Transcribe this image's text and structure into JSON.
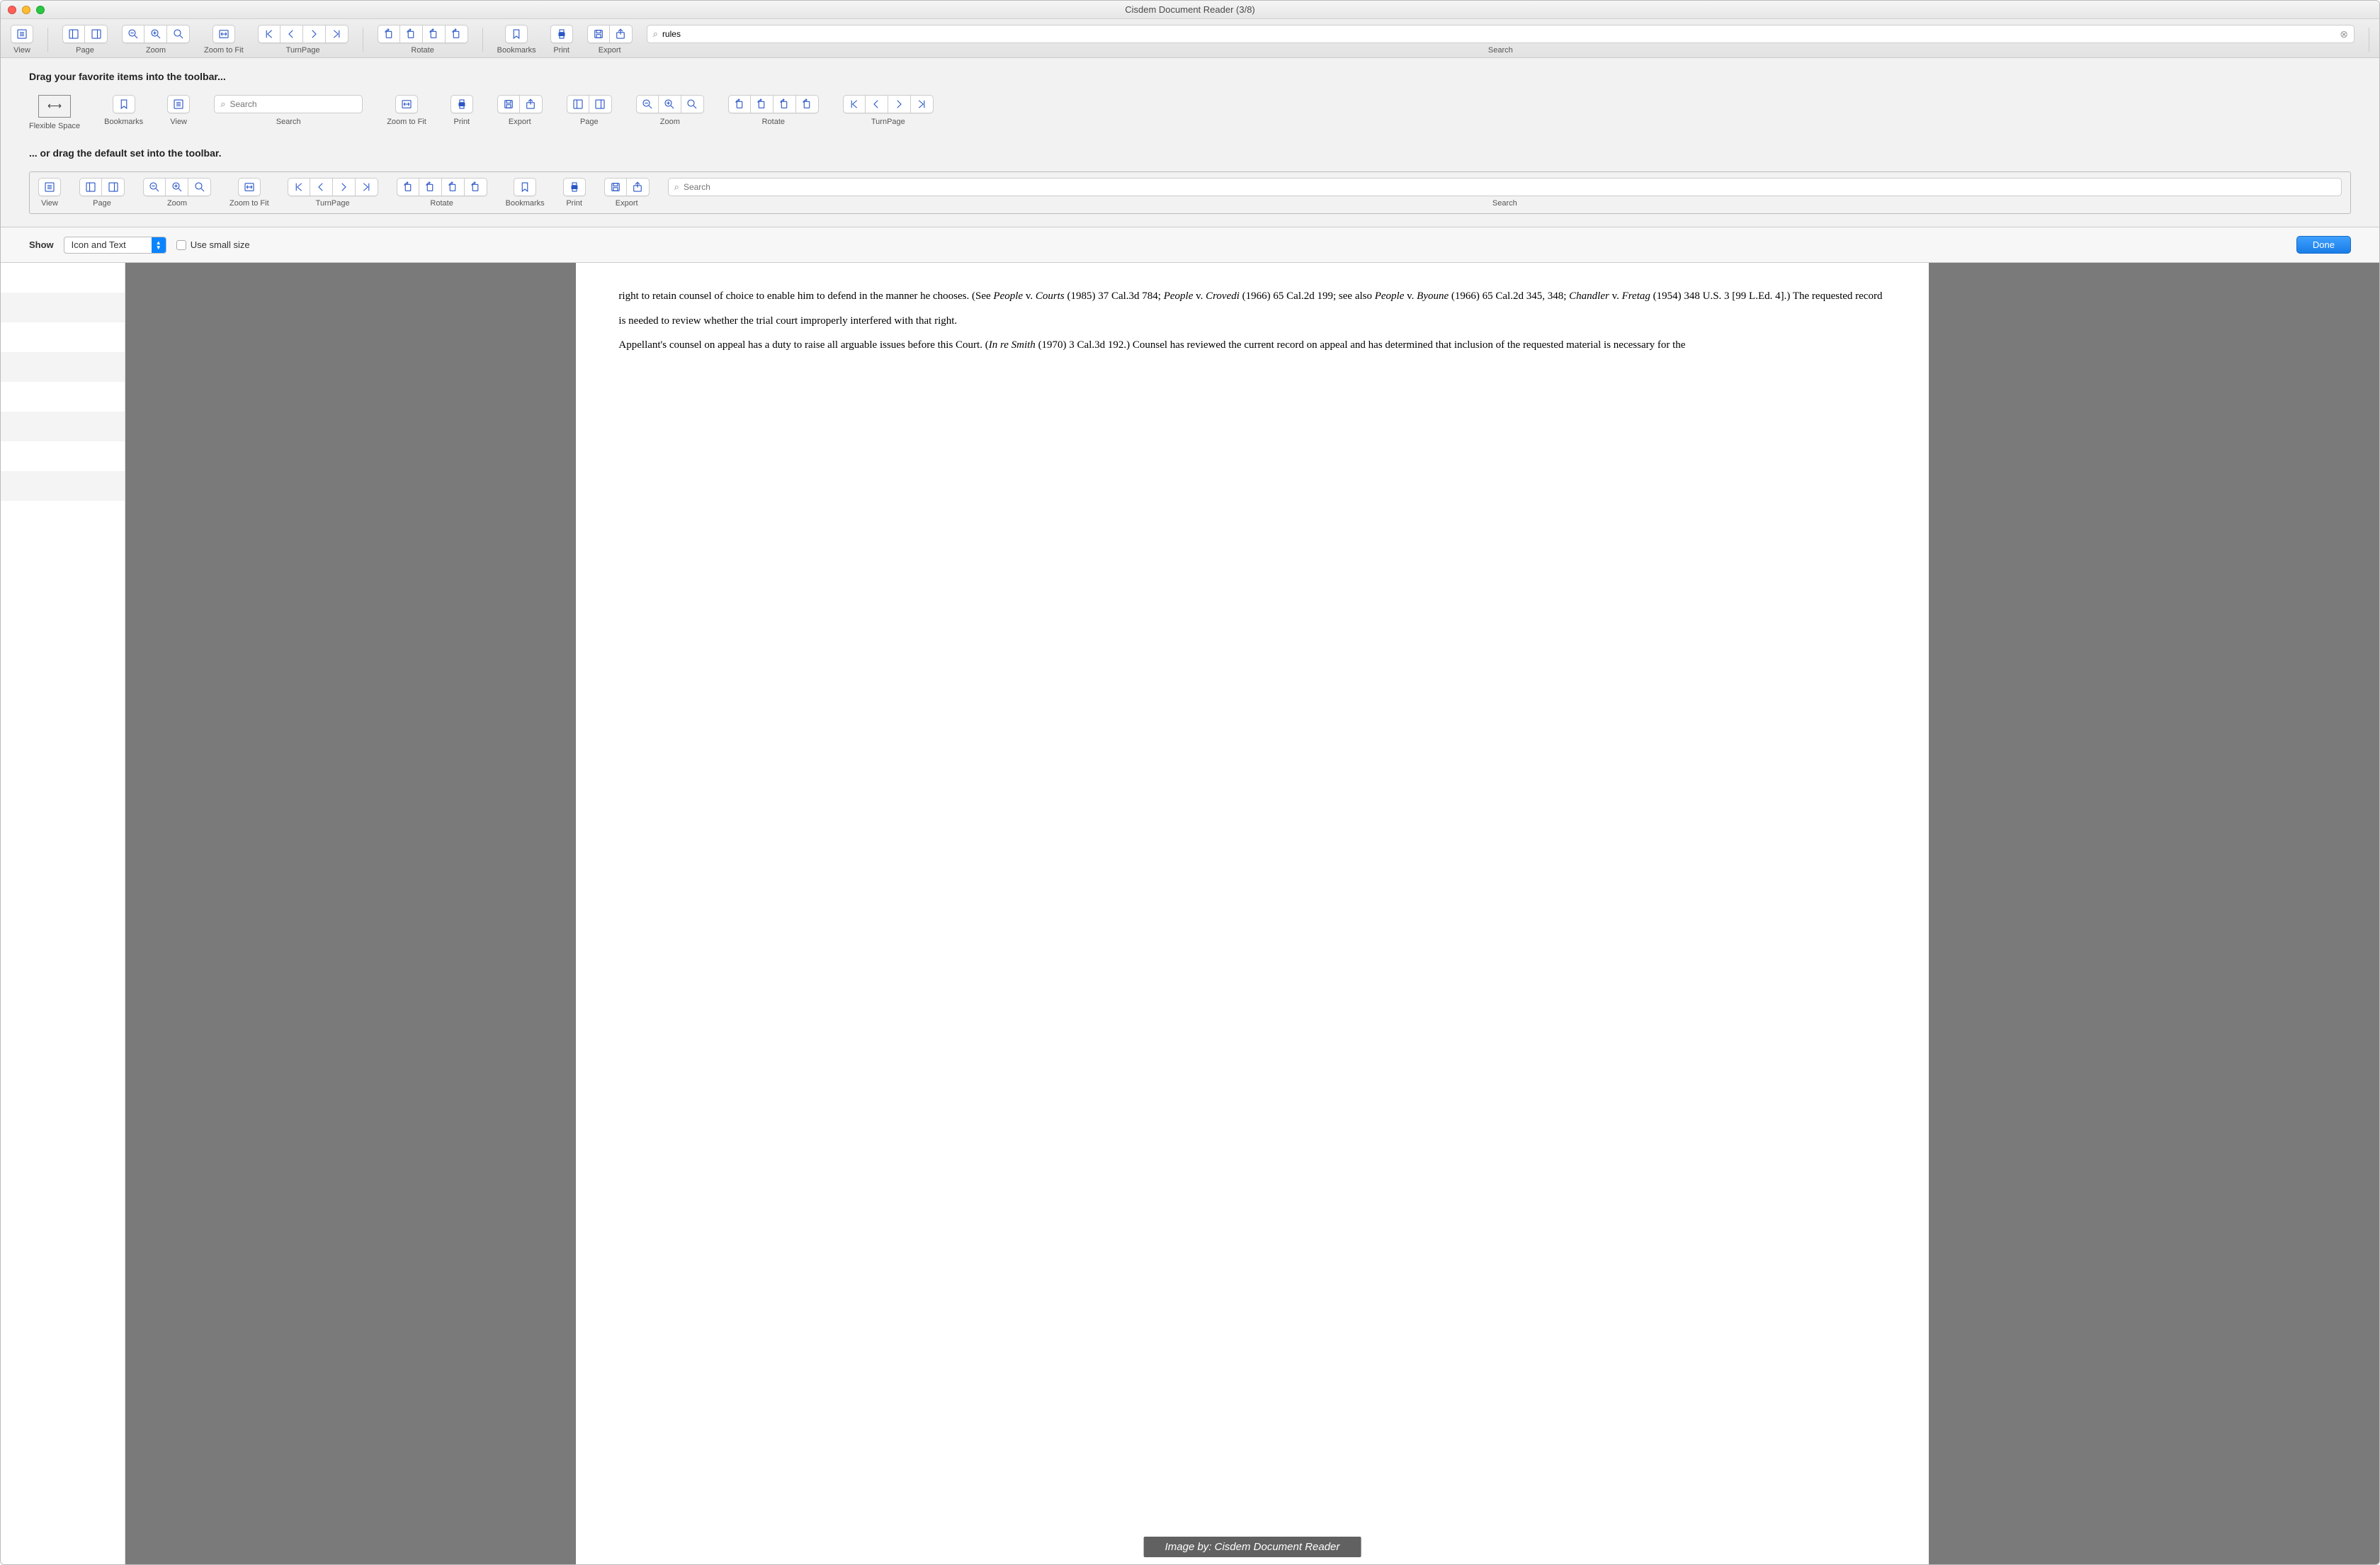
{
  "window": {
    "title": "Cisdem Document Reader (3/8)"
  },
  "toolbar": {
    "view": "View",
    "page": "Page",
    "zoom": "Zoom",
    "zoomfit": "Zoom to Fit",
    "turnpage": "TurnPage",
    "rotate": "Rotate",
    "bookmarks": "Bookmarks",
    "print": "Print",
    "export": "Export",
    "search": "Search",
    "search_value": "rules"
  },
  "customize": {
    "heading1": "Drag your favorite items into the toolbar...",
    "heading2": "... or drag the default set into the toolbar.",
    "items": {
      "flexspace": "Flexible Space",
      "bookmarks": "Bookmarks",
      "view": "View",
      "search": "Search",
      "zoomfit": "Zoom to Fit",
      "print": "Print",
      "export": "Export",
      "page": "Page",
      "zoom": "Zoom",
      "rotate": "Rotate",
      "turnpage": "TurnPage",
      "search_placeholder": "Search"
    },
    "default_labels": {
      "view": "View",
      "page": "Page",
      "zoom": "Zoom",
      "zoomfit": "Zoom to Fit",
      "turnpage": "TurnPage",
      "rotate": "Rotate",
      "bookmarks": "Bookmarks",
      "print": "Print",
      "export": "Export",
      "search": "Search",
      "search_placeholder": "Search"
    }
  },
  "footer": {
    "show": "Show",
    "show_option": "Icon and Text",
    "smallsize": "Use small size",
    "done": "Done"
  },
  "document": {
    "p1a": "right to retain counsel of choice to enable him to defend in the manner he chooses. (See ",
    "p1b": "People",
    "p1c": " v. ",
    "p1d": "Courts",
    "p1e": " (1985) 37 Cal.3d 784; ",
    "p1f": "People",
    "p1g": " v. ",
    "p1h": "Crovedi",
    "p1i": " (1966) 65 Cal.2d 199; see also ",
    "p1j": "People",
    "p1k": " v. ",
    "p1l": "Byoune",
    "p1m": " (1966) 65 Cal.2d 345, 348; ",
    "p1n": "Chandler",
    "p1o": " v. ",
    "p1p": "Fretag",
    "p1q": " (1954) 348 U.S. 3 [99 L.Ed. 4].)  The requested record is needed to review whether the trial court improperly interfered with that right.",
    "p2a": "Appellant's counsel on appeal has a duty to raise all arguable issues before this Court. (",
    "p2b": "In re Smith",
    "p2c": " (1970) 3 Cal.3d 192.)  Counsel has reviewed the current record on appeal and has determined that inclusion of the requested material is necessary for the"
  },
  "caption": "Image by: Cisdem Document Reader"
}
